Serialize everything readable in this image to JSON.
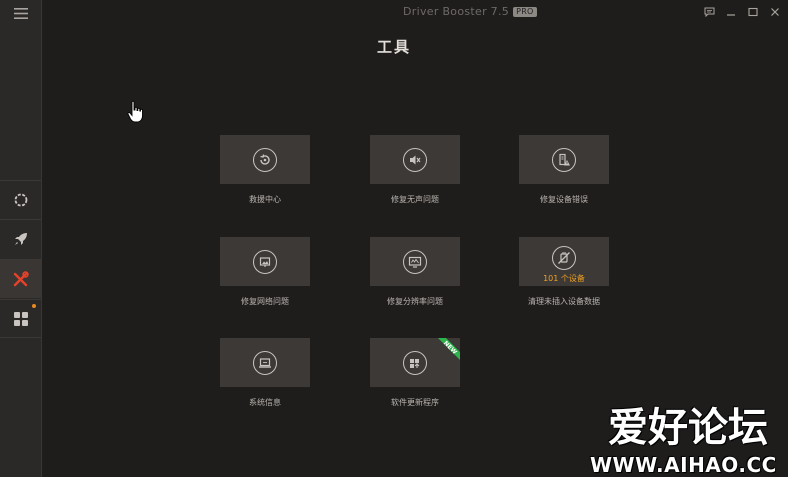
{
  "app": {
    "title": "Driver Booster 7.5",
    "edition_badge": "PRO",
    "page_title": "工具"
  },
  "sidebar": {
    "menu_icon": "hamburger-icon",
    "items": [
      {
        "name": "scan",
        "icon": "circle-dots-icon",
        "active": false
      },
      {
        "name": "boost",
        "icon": "rocket-icon",
        "active": false
      },
      {
        "name": "tools",
        "icon": "tools-icon",
        "active": true
      },
      {
        "name": "action-center",
        "icon": "grid-icon",
        "active": false,
        "notification_dot": true
      }
    ]
  },
  "window_controls": [
    "feedback-icon",
    "minimize-icon",
    "maximize-icon",
    "close-icon"
  ],
  "tools": [
    {
      "label": "救援中心",
      "icon": "restore-icon"
    },
    {
      "label": "修复无声问题",
      "icon": "mute-speaker-icon"
    },
    {
      "label": "修复设备错误",
      "icon": "device-warning-icon"
    },
    {
      "label": "修复网络问题",
      "icon": "network-icon"
    },
    {
      "label": "修复分辨率问题",
      "icon": "monitor-icon"
    },
    {
      "label": "清理未插入设备数据",
      "icon": "usb-unplugged-icon",
      "count_text": "101 个设备"
    },
    {
      "label": "系统信息",
      "icon": "laptop-icon"
    },
    {
      "label": "软件更新程序",
      "icon": "software-update-icon",
      "ribbon": "NEW"
    }
  ],
  "watermark": {
    "cn": "爱好论坛",
    "en": "WWW.AIHAO.CC"
  },
  "colors": {
    "background": "#1f1d1c",
    "sidebar": "#2b2927",
    "tile": "#3c3937",
    "active_icon": "#e8412a",
    "accent_orange": "#e58a21",
    "new_ribbon": "#2db44a"
  }
}
